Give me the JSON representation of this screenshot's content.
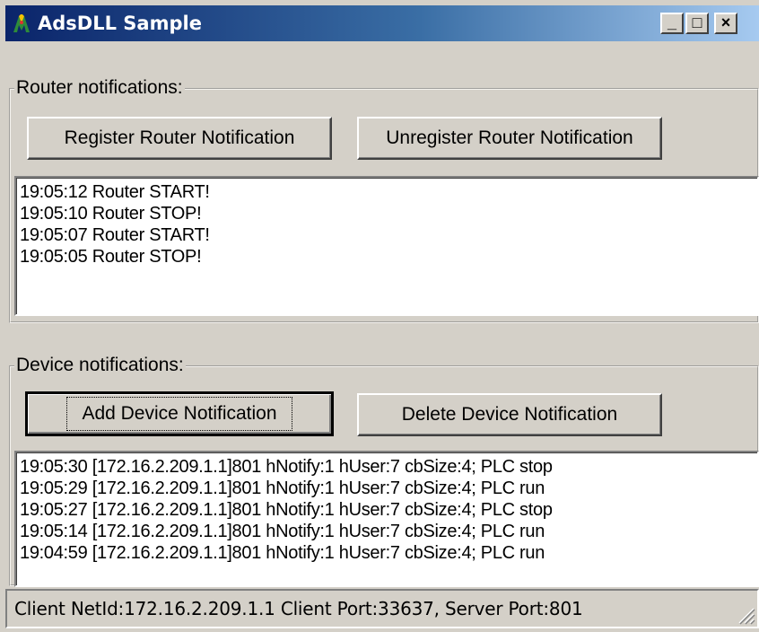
{
  "window": {
    "title": "AdsDLL Sample",
    "controls": {
      "minimize": "_",
      "maximize": "□",
      "close": "×"
    }
  },
  "router_group": {
    "label": "Router notifications:",
    "register_button": "Register Router Notification",
    "unregister_button": "Unregister Router Notification",
    "log": [
      "19:05:12 Router START!",
      "19:05:10 Router STOP!",
      "19:05:07 Router START!",
      "19:05:05 Router STOP!"
    ]
  },
  "device_group": {
    "label": "Device notifications:",
    "add_button": "Add Device Notification",
    "delete_button": "Delete Device Notification",
    "log": [
      "19:05:30 [172.16.2.209.1.1]801 hNotify:1 hUser:7 cbSize:4; PLC stop",
      "19:05:29 [172.16.2.209.1.1]801 hNotify:1 hUser:7 cbSize:4; PLC run",
      "19:05:27 [172.16.2.209.1.1]801 hNotify:1 hUser:7 cbSize:4; PLC stop",
      "19:05:14 [172.16.2.209.1.1]801 hNotify:1 hUser:7 cbSize:4; PLC run",
      "19:04:59 [172.16.2.209.1.1]801 hNotify:1 hUser:7 cbSize:4; PLC run"
    ]
  },
  "status_bar": {
    "text": "Client NetId:172.16.2.209.1.1  Client Port:33637,  Server Port:801"
  },
  "colors": {
    "title_gradient_start": "#0a246a",
    "title_gradient_end": "#a6caf0",
    "face": "#d4d0c8"
  }
}
